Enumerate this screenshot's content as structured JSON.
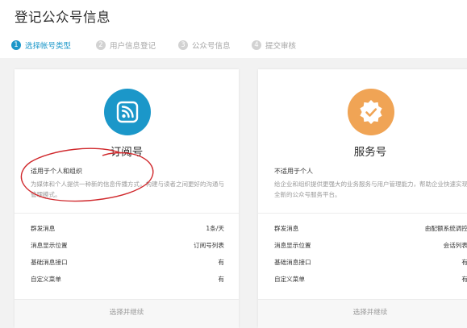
{
  "page": {
    "title": "登记公众号信息"
  },
  "steps": [
    {
      "number": "1",
      "label": "选择帐号类型",
      "state": "active"
    },
    {
      "number": "2",
      "label": "用户信息登记",
      "state": "inactive"
    },
    {
      "number": "3",
      "label": "公众号信息",
      "state": "inactive"
    },
    {
      "number": "4",
      "label": "提交审核",
      "state": "inactive"
    }
  ],
  "cards": [
    {
      "icon": "rss-feed-icon",
      "icon_color": "#1b97c9",
      "title": "订阅号",
      "suitable_for": "适用于个人和组织",
      "description": "为媒体和个人提供一种新的信息传播方式，构建与读者之间更好的沟通与管理模式。",
      "features": [
        {
          "name": "群发消息",
          "value": "1条/天"
        },
        {
          "name": "消息显示位置",
          "value": "订阅号列表"
        },
        {
          "name": "基础消息接口",
          "value": "有"
        },
        {
          "name": "自定义菜单",
          "value": "有"
        }
      ],
      "select_label": "选择并继续"
    },
    {
      "icon": "badge-check-icon",
      "icon_color": "#f0a455",
      "title": "服务号",
      "suitable_for": "不适用于个人",
      "description": "给企业和组织提供更强大的业务服务与用户管理能力，帮助企业快速实现全新的公众号服务平台。",
      "features": [
        {
          "name": "群发消息",
          "value": "由配额系统调控"
        },
        {
          "name": "消息显示位置",
          "value": "会话列表"
        },
        {
          "name": "基础消息接口",
          "value": "有"
        },
        {
          "name": "自定义菜单",
          "value": "有"
        }
      ],
      "select_label": "选择并继续"
    }
  ],
  "annotation": {
    "color": "#d0282c"
  }
}
